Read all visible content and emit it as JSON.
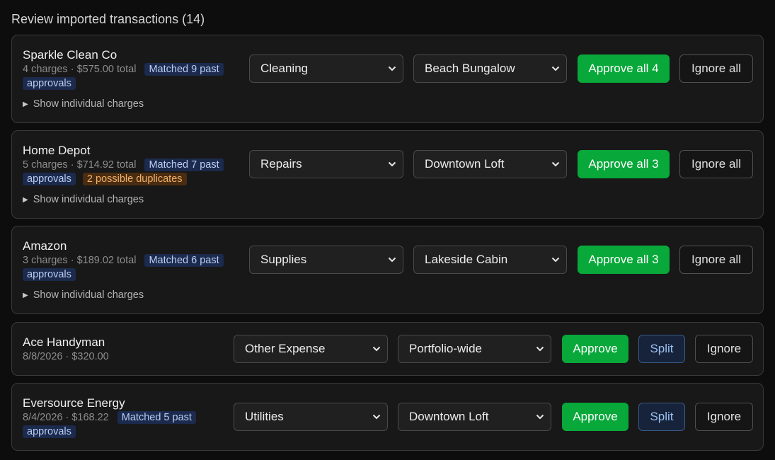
{
  "page": {
    "title": "Review imported transactions (14)"
  },
  "toggle_label": "Show individual charges",
  "colors": {
    "approve_green": "#08a83a",
    "badge_blue_bg": "#1b2a4d",
    "badge_orange_bg": "#4a2c10",
    "split_blue": "#9cc0f0"
  },
  "groups": [
    {
      "vendor": "Sparkle Clean Co",
      "meta": "4 charges · $575.00 total",
      "match_badge": "Matched 9 past approvals",
      "category": "Cleaning",
      "property": "Beach Bungalow",
      "approve_label": "Approve all 4",
      "ignore_label": "Ignore all"
    },
    {
      "vendor": "Home Depot",
      "meta": "5 charges · $714.92 total",
      "match_badge": "Matched 7 past approvals",
      "warning_badge": "2 possible duplicates",
      "category": "Repairs",
      "property": "Downtown Loft",
      "approve_label": "Approve all 3",
      "ignore_label": "Ignore all"
    },
    {
      "vendor": "Amazon",
      "meta": "3 charges · $189.02 total",
      "match_badge": "Matched 6 past approvals",
      "category": "Supplies",
      "property": "Lakeside Cabin",
      "approve_label": "Approve all 3",
      "ignore_label": "Ignore all"
    }
  ],
  "singles": [
    {
      "vendor": "Ace Handyman",
      "meta": "8/8/2026 · $320.00",
      "category": "Other Expense",
      "property": "Portfolio-wide",
      "approve_label": "Approve",
      "split_label": "Split",
      "ignore_label": "Ignore"
    },
    {
      "vendor": "Eversource Energy",
      "meta": "8/4/2026 · $168.22",
      "match_badge": "Matched 5 past approvals",
      "category": "Utilities",
      "property": "Downtown Loft",
      "approve_label": "Approve",
      "split_label": "Split",
      "ignore_label": "Ignore"
    }
  ]
}
